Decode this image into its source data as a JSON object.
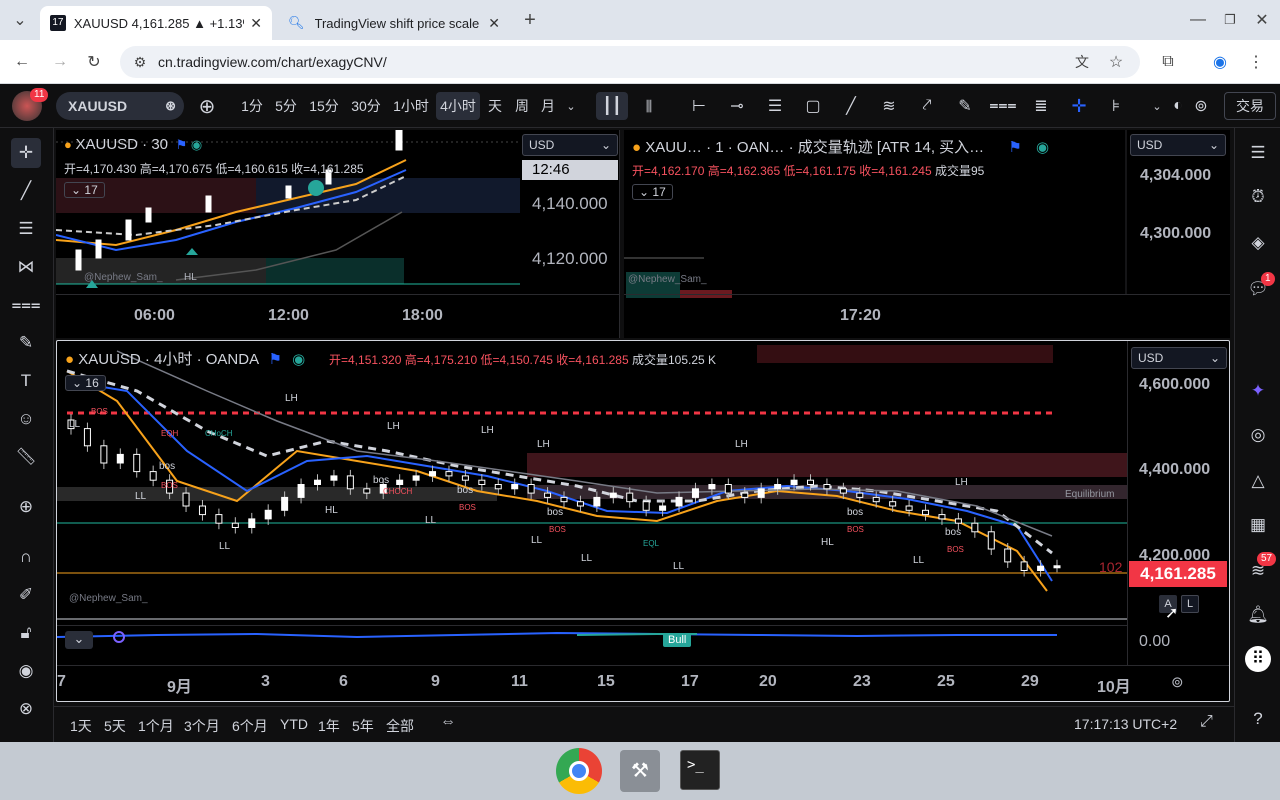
{
  "browser": {
    "tabs": [
      {
        "title": "XAUUSD 4,161.285 ▲ +1.13%",
        "active": true
      },
      {
        "title": "TradingView shift price scale",
        "active": false
      }
    ],
    "url": "cn.tradingview.com/chart/exagyCNV/"
  },
  "toolbar": {
    "avatar_badge": "11",
    "symbol": "XAUUSD",
    "intervals": [
      "1分",
      "5分",
      "15分",
      "30分",
      "1小时",
      "4小时",
      "天",
      "周",
      "月"
    ],
    "selected_interval": "4小时",
    "trade_label": "交易"
  },
  "top_left_pane": {
    "title": "XAUUSD · 30",
    "ohlc": "开=4,170.430 高=4,170.675 低=4,160.615 收=4,161.285",
    "indicator_count": "17",
    "watermark": "@Nephew_Sam_",
    "label_hl": "HL",
    "currency": "USD",
    "countdown": "12:46",
    "price_ticks": [
      "4,140.000",
      "4,120.000"
    ],
    "time_ticks": [
      "06:00",
      "12:00",
      "18:00"
    ]
  },
  "top_right_pane": {
    "title": "XAUU… · 1 · OAN… · 成交量轨迹 [ATR 14, 买入…",
    "ohlc_open": "开=4,162.170",
    "ohlc_high": "高=4,162.365",
    "ohlc_low": "低=4,161.175",
    "ohlc_close": "收=4,161.245",
    "volume": "成交量95",
    "indicator_count": "17",
    "watermark": "@Nephew_Sam_",
    "currency": "USD",
    "price_ticks": [
      "4,304.000",
      "4,300.000"
    ],
    "time_tick": "17:20"
  },
  "main_pane": {
    "title": "XAUUSD · 4小时 · OANDA",
    "open": "开=4,151.320",
    "high": "高=4,175.210",
    "low": "低=4,150.745",
    "close": "收=4,161.285",
    "volume": "成交量105.25 K",
    "indicator_count": "16",
    "currency": "USD",
    "price_ticks": [
      "4,600.000",
      "4,400.000",
      "4,200.000",
      "0.00"
    ],
    "last_price": "4,161.285",
    "last_price_color": "#f23645",
    "equilibrium": "Equilibrium",
    "watermark": "@Nephew_Sam_",
    "bull_label": "Bull",
    "side_value": "102",
    "btn_a": "A",
    "btn_l": "L",
    "date_ticks": [
      "7",
      "9月",
      "3",
      "6",
      "9",
      "11",
      "15",
      "17",
      "20",
      "23",
      "25",
      "29",
      "10月"
    ],
    "annotations": {
      "lh": "LH",
      "ll": "LL",
      "hl": "HL",
      "bos": "bos",
      "bos_red": "BOS",
      "eql": "EQL",
      "eqh": "EQH",
      "chhoch": "CHoCH",
      "choch": "CHOCH"
    },
    "candles_open": [
      4500,
      4480,
      4440,
      4400,
      4420,
      4380,
      4360,
      4330,
      4300,
      4280,
      4260,
      4250,
      4270,
      4290,
      4320,
      4350,
      4360,
      4370,
      4340,
      4330,
      4350,
      4360,
      4370,
      4380,
      4370,
      4360,
      4350,
      4340,
      4350,
      4330,
      4320,
      4310,
      4300,
      4320,
      4330,
      4310,
      4290,
      4300,
      4320,
      4340,
      4350,
      4330,
      4320,
      4340,
      4350,
      4360,
      4350,
      4340,
      4330,
      4320,
      4310,
      4300,
      4290,
      4280,
      4270,
      4260,
      4240,
      4200,
      4170,
      4150,
      4160
    ],
    "candles_close": [
      4480,
      4440,
      4400,
      4420,
      4380,
      4360,
      4330,
      4300,
      4280,
      4260,
      4250,
      4270,
      4290,
      4320,
      4350,
      4360,
      4370,
      4340,
      4330,
      4350,
      4360,
      4370,
      4380,
      4370,
      4360,
      4350,
      4340,
      4350,
      4330,
      4320,
      4310,
      4300,
      4320,
      4330,
      4310,
      4290,
      4300,
      4320,
      4340,
      4350,
      4330,
      4320,
      4340,
      4350,
      4360,
      4350,
      4340,
      4330,
      4320,
      4310,
      4300,
      4290,
      4280,
      4270,
      4260,
      4240,
      4200,
      4170,
      4150,
      4160,
      4161
    ]
  },
  "bottom_bar": {
    "ranges": [
      "1天",
      "5天",
      "1个月",
      "3个月",
      "6个月",
      "YTD",
      "1年",
      "5年",
      "全部"
    ],
    "clock": "17:17:13 UTC+2"
  },
  "right_sidebar": {
    "notif_badge": "1",
    "feed_badge": "57"
  }
}
